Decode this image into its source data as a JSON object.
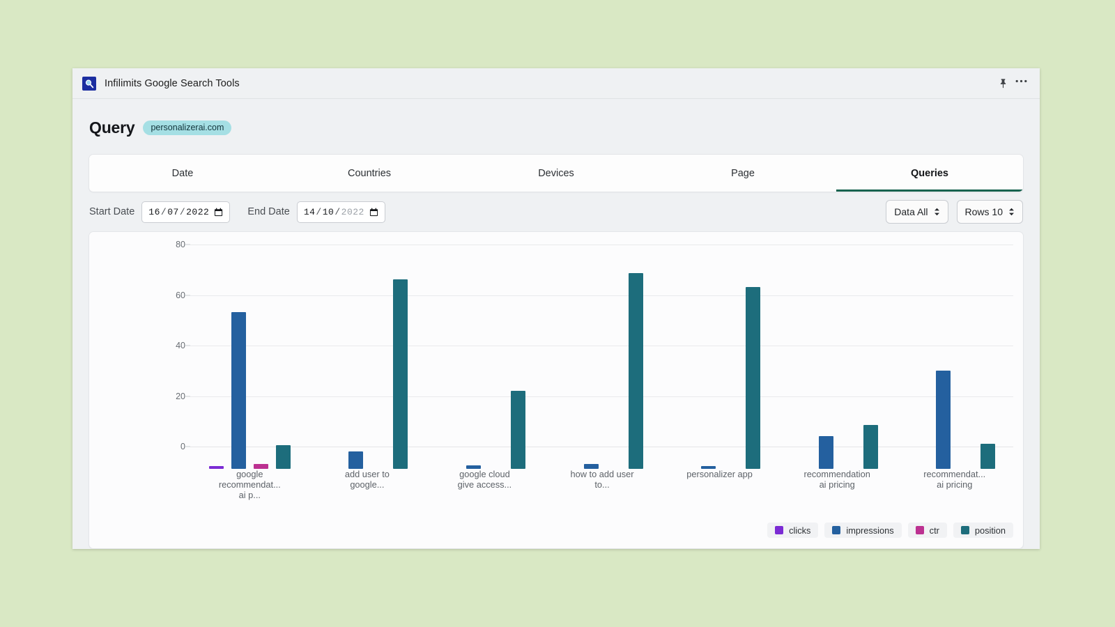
{
  "window": {
    "title": "Infilimits Google Search Tools",
    "app_icon": "search-magnifier-icon",
    "pin_icon": "pin-icon",
    "more_icon": "more-options-icon"
  },
  "header": {
    "title": "Query",
    "domain_chip": "personalizerai.com"
  },
  "tabs": [
    {
      "label": "Date",
      "active": false
    },
    {
      "label": "Countries",
      "active": false
    },
    {
      "label": "Devices",
      "active": false
    },
    {
      "label": "Page",
      "active": false
    },
    {
      "label": "Queries",
      "active": true
    }
  ],
  "controls": {
    "start_date_label": "Start Date",
    "start_date_value": "16/07/2022",
    "start_date_day": "16",
    "start_date_month": "07",
    "start_date_year": "2022",
    "end_date_label": "End Date",
    "end_date_value": "14/10/2022",
    "end_date_day": "14",
    "end_date_month": "10",
    "end_date_year": "2022",
    "data_select": "Data All",
    "rows_select": "Rows 10"
  },
  "colors": {
    "clicks": "#7b2bd4",
    "impressions": "#24609f",
    "ctr": "#bc3191",
    "position": "#1d6d7c",
    "accent": "#18634f",
    "chip": "#a5dfe4"
  },
  "chart_data": {
    "type": "bar",
    "title": "",
    "xlabel": "",
    "ylabel": "",
    "ylim": [
      0,
      80
    ],
    "yticks": [
      0,
      20,
      40,
      60,
      80
    ],
    "grid": true,
    "legend_position": "bottom-right",
    "categories": [
      "google recommendat... ai p...",
      "add user to google...",
      "google cloud give access...",
      "how to add user to...",
      "personalizer app",
      "recommendation ai pricing",
      "recommendat... ai pricing"
    ],
    "category_lines": [
      [
        "google",
        "recommendat...",
        "ai p..."
      ],
      [
        "add user to",
        "google..."
      ],
      [
        "google cloud",
        "give access..."
      ],
      [
        "how to add user",
        "to..."
      ],
      [
        "personalizer app"
      ],
      [
        "recommendation",
        "ai pricing"
      ],
      [
        "recommendat...",
        "ai pricing"
      ]
    ],
    "series": [
      {
        "name": "clicks",
        "color": "#7b2bd4",
        "values": [
          1,
          0,
          0,
          0,
          0,
          0,
          0
        ]
      },
      {
        "name": "impressions",
        "color": "#24609f",
        "values": [
          62,
          7,
          1.5,
          2,
          1,
          13,
          39
        ]
      },
      {
        "name": "ctr",
        "color": "#bc3191",
        "values": [
          2,
          0,
          0,
          0,
          0,
          0,
          0
        ]
      },
      {
        "name": "position",
        "color": "#1d6d7c",
        "values": [
          9.5,
          75,
          31,
          77.5,
          72,
          17.5,
          10
        ]
      }
    ]
  }
}
